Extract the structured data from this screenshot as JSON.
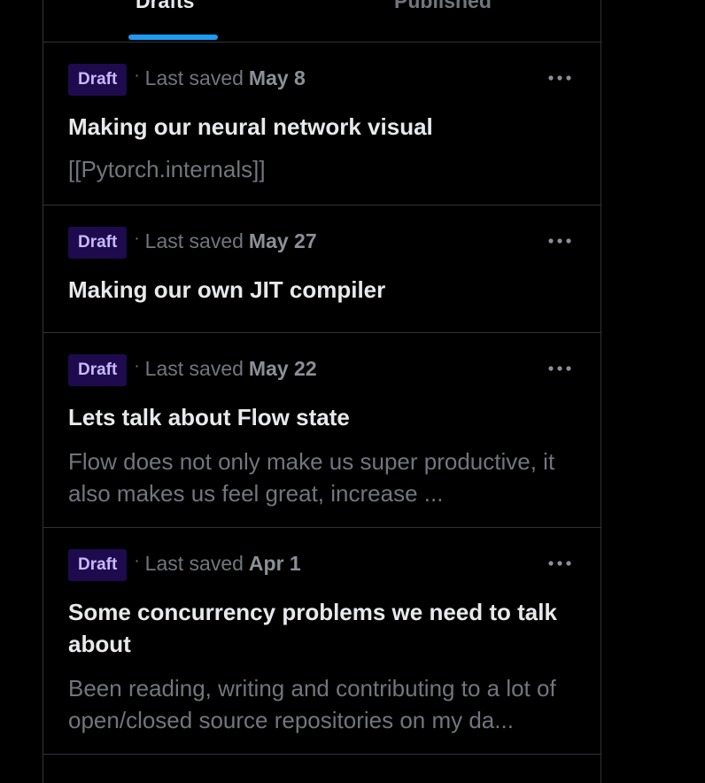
{
  "tabs": {
    "drafts_label": "Drafts",
    "published_label": "Published"
  },
  "colors": {
    "accent": "#1d9bf0",
    "badge_bg": "#1e0b4d",
    "badge_text": "#c9b8ff"
  },
  "drafts": [
    {
      "badge": "Draft",
      "saved_label": "Last saved",
      "saved_date": "May 8",
      "title": "Making our neural network visual",
      "excerpt": "[[Pytorch.internals]]"
    },
    {
      "badge": "Draft",
      "saved_label": "Last saved",
      "saved_date": "May 27",
      "title": "Making our own JIT compiler",
      "excerpt": ""
    },
    {
      "badge": "Draft",
      "saved_label": "Last saved",
      "saved_date": "May 22",
      "title": "Lets talk about Flow state",
      "excerpt": "Flow does not only make us super productive, it also makes us feel great, increase ..."
    },
    {
      "badge": "Draft",
      "saved_label": "Last saved",
      "saved_date": "Apr 1",
      "title": "Some concurrency problems we need to talk about",
      "excerpt": "Been reading, writing and contributing to a lot of open/closed source repositories on my da..."
    }
  ],
  "icons": {
    "more": "more-horizontal-icon"
  }
}
